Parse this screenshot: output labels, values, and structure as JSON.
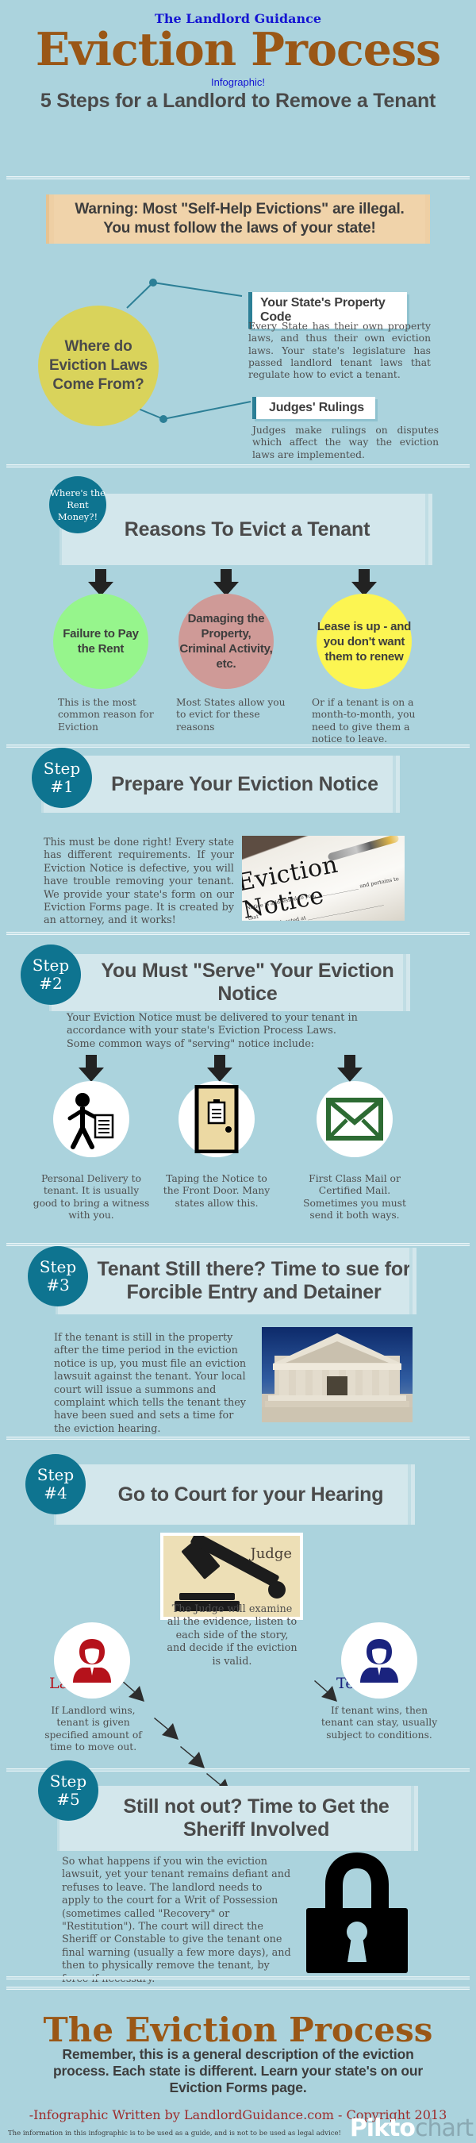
{
  "header": {
    "brand": "The Landlord Guidance",
    "title": "Eviction Process",
    "infographic_label": "Infographic!",
    "subtitle": "5 Steps for a Landlord to Remove a Tenant"
  },
  "warning": {
    "line1": "Warning: Most \"Self-Help Evictions\" are illegal.",
    "line2": "You must follow the laws of your state!"
  },
  "laws": {
    "circle_label": "Where do Eviction Laws Come From?",
    "callouts": [
      {
        "title": "Your State's Property Code",
        "body": "Every State has their own property laws, and thus their own eviction laws.  Your state's legislature has passed landlord tenant laws that regulate how to evict a tenant."
      },
      {
        "title": "Judges' Rulings",
        "body": "Judges make rulings on disputes which affect the way the eviction laws are implemented."
      }
    ]
  },
  "reasons": {
    "badge": "Where's the Rent Money?!",
    "heading": "Reasons To Evict a Tenant",
    "items": [
      {
        "label": "Failure to Pay the Rent",
        "caption": "This is the most common reason for Eviction",
        "color": "#96f58c"
      },
      {
        "label": "Damaging the Property, Criminal Activity, etc.",
        "caption": "Most States allow you to evict for these reasons",
        "color": "#cf9a97"
      },
      {
        "label": "Lease is up - and you don't want them to renew",
        "caption": "Or if a tenant is on a month-to-month, you need to give them a notice to leave.",
        "color": "#fcf552"
      }
    ]
  },
  "steps": [
    {
      "badge_word": "Step",
      "badge_num": "#1",
      "title": "Prepare Your Eviction Notice",
      "body": "This must be done right!  Every state has different requirements.  If your Eviction Notice is defective, you will have trouble removing your tenant.  We provide your state's form on our Eviction Forms page.  It is created by an attorney, and it works!",
      "photo_caption": "Eviction Notice"
    },
    {
      "badge_word": "Step",
      "badge_num": "#2",
      "title": "You Must \"Serve\" Your Eviction Notice",
      "body": "Your Eviction Notice must be delivered to your tenant in accordance with your state's Eviction Process Laws. Some common ways of \"serving\" notice include:",
      "methods": [
        {
          "icon": "person-with-document-icon",
          "caption": "Personal Delivery to tenant.  It is usually good to bring a witness with you."
        },
        {
          "icon": "door-with-notice-icon",
          "caption": "Taping the Notice to the Front Door.  Many states allow this."
        },
        {
          "icon": "envelope-icon",
          "caption": "First Class Mail or Certified Mail.  Sometimes you must send it both ways."
        }
      ]
    },
    {
      "badge_word": "Step",
      "badge_num": "#3",
      "title": "Tenant Still there?  Time to sue for Forcible Entry and Detainer",
      "body": "If the tenant is still in the property after the time period in the eviction notice is up, you must file an eviction lawsuit against the tenant.  Your local court will issue a summons and complaint which tells the tenant they have been sued and sets a time for the eviction hearing."
    },
    {
      "badge_word": "Step",
      "badge_num": "#4",
      "title": "Go to Court for your Hearing",
      "judge_label": "Judge",
      "judge_body": "The Judge will examine all the evidence, listen to each side of the story, and decide if the eviction is valid.",
      "landlord_label": "Landlord",
      "landlord_caption": "If Landlord wins, tenant is given specified amount of time to move out.",
      "tenant_label": "Tenant",
      "tenant_caption": "If tenant wins, then tenant can stay, usually subject to conditions."
    },
    {
      "badge_word": "Step",
      "badge_num": "#5",
      "title": "Still not out? Time to Get the Sheriff Involved",
      "body": "So what happens if you win the eviction lawsuit, yet your tenant remains defiant and refuses to leave.  The landlord needs to apply to the court for a Writ of Possession (sometimes called \"Recovery\" or \"Restitution\").  The court will direct the Sheriff or Constable to give the tenant one final warning (usually a few more days), and then to physically remove the tenant, by force if necessary."
    }
  ],
  "footer": {
    "title": "The Eviction Process",
    "subtitle": "Remember, this is a general description of the eviction process.  Each state is different.  Learn your state's on our Eviction Forms page.",
    "credit": "-Infographic Written by LandlordGuidance.com - Copyright 2013",
    "disclaimer": "The information in this infographic is to be used as a guide, and is not to be used as legal advice!",
    "watermark_a": "Pikto",
    "watermark_b": "chart"
  },
  "colors": {
    "background": "#abd3dd",
    "brand_blue": "#1414d2",
    "title_brown": "#9a5716",
    "teal": "#0e7490",
    "warning_tan": "#f0d3aa",
    "bar_light": "#d3e7ec",
    "yellow_circle": "#d9d35b",
    "landlord_red": "#b5121b",
    "tenant_blue": "#1a237e",
    "envelope_green": "#2d6b33"
  }
}
